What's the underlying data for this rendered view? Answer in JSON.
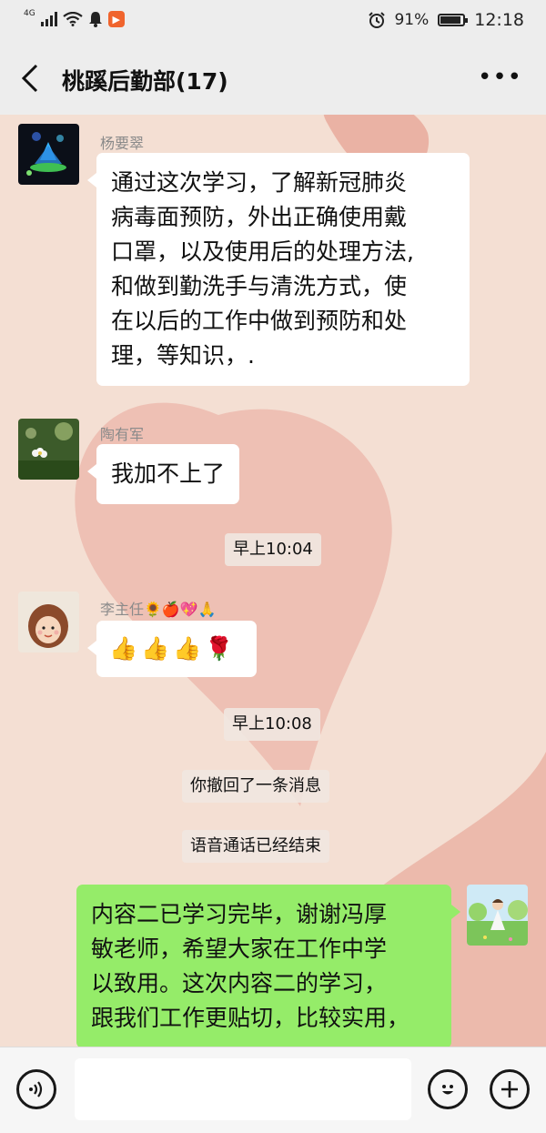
{
  "status_bar": {
    "network": "4G",
    "battery_percent": "91%",
    "battery_level": 0.91,
    "time": "12:18",
    "icons": [
      "signal-icon",
      "wifi-icon",
      "notification-bell-icon",
      "app-notification-icon",
      "alarm-icon",
      "battery-icon"
    ]
  },
  "header": {
    "title": "桃蹊后勤部(17)",
    "back_icon": "chevron-left-icon",
    "more_icon": "more-dots-icon",
    "more_label": "•••"
  },
  "messages": [
    {
      "sender": "杨要翠",
      "side": "left",
      "avatar": "lotus-lantern-avatar",
      "lines": [
        "通过这次学习，了解新冠肺炎",
        "病毒面预防，外出正确使用戴",
        "口罩，以及使用后的处理方法,",
        "和做到勤洗手与清洗方式，使",
        "在以后的工作中做到预防和处",
        "理，等知识，."
      ]
    },
    {
      "sender": "陶有军",
      "side": "left",
      "avatar": "flower-avatar",
      "lines": [
        "我加不上了"
      ]
    },
    {
      "type": "time",
      "text": "早上10:04"
    },
    {
      "sender": "李主任🌻🍎💖🙏",
      "side": "left",
      "avatar": "cartoon-girl-avatar",
      "emojis": [
        "👍",
        "👍",
        "👍",
        "🌹"
      ]
    },
    {
      "type": "time",
      "text": "早上10:08"
    },
    {
      "type": "system",
      "text": "你撤回了一条消息"
    },
    {
      "type": "system",
      "text": "语音通话已经结束"
    },
    {
      "side": "right",
      "avatar": "girl-in-field-avatar",
      "lines": [
        "内容二已学习完毕，谢谢冯厚",
        "敏老师，希望大家在工作中学",
        "以致用。这次内容二的学习，",
        "跟我们工作更贴切，比较实用，"
      ]
    }
  ],
  "input_bar": {
    "voice_icon": "voice-input-icon",
    "emoji_icon": "emoji-face-icon",
    "add_icon": "plus-circle-icon",
    "text_value": ""
  },
  "colors": {
    "self_bubble": "#95ec69",
    "other_bubble": "#ffffff",
    "bar_background": "#ededed",
    "chat_background": "#f4dfd3"
  }
}
